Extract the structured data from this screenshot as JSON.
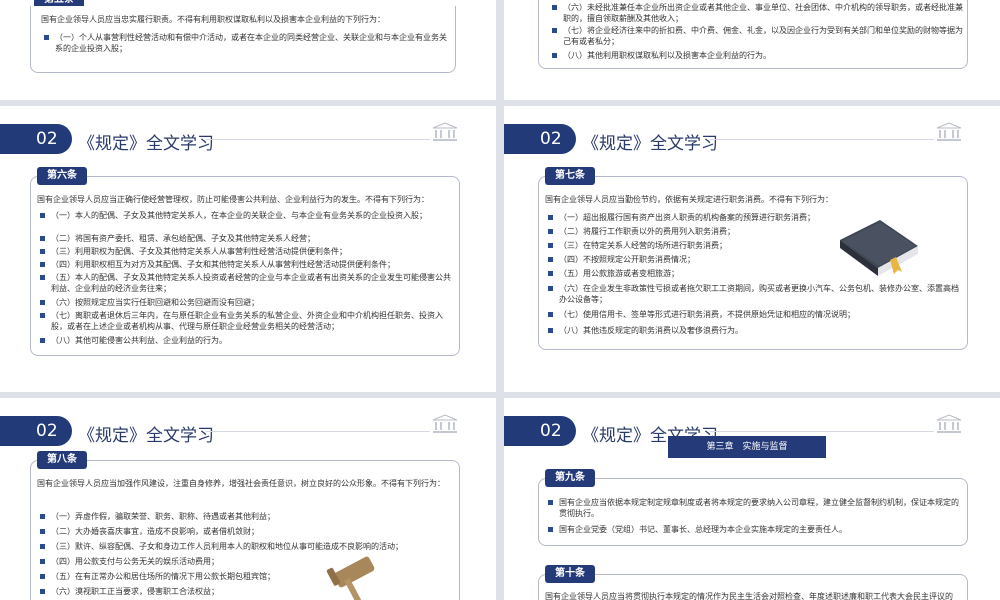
{
  "section": {
    "num": "02",
    "title": "《规定》全文学习"
  },
  "slide1": {
    "intro": "国有企业领导人员应当廉洁从业，严于律己，不得违反规定获取个人利益，并不得利用职权谋取私利。",
    "p1": "国有企业领导人员应当忠实履行职责。不得有利用职权谋取私利以及损害本企业利益的下列行为：",
    "items": [
      "（一）个人从事营利性经营活动和有偿中介活动，或者在本企业的同类经营企业、关联企业和与本企业有业务关系的企业投资入股；"
    ]
  },
  "slide2": {
    "items": [
      "（六）未经批准兼任本企业所出资企业或者其他企业、事业单位、社会团体、中介机构的领导职务，或者经批准兼职的，擅自领取薪酬及其他收入；",
      "（七）将企业经济往来中的折扣费、中介费、佣金、礼金，以及因企业行为受到有关部门和单位奖励的财物等据为己有或者私分；",
      "（八）其他利用职权谋取私利以及损害本企业利益的行为。"
    ]
  },
  "slide3": {
    "tab": "第六条",
    "intro": "国有企业领导人员应当正确行使经营管理权，防止可能侵害公共利益、企业利益行为的发生。不得有下列行为：",
    "items": [
      "（一）本人的配偶、子女及其他特定关系人，在本企业的关联企业、与本企业有业务关系的企业投资入股；",
      "（二）将国有资产委托、租赁、承包给配偶、子女及其他特定关系人经营；",
      "（三）利用职权为配偶、子女及其他特定关系人从事营利性经营活动提供便利条件；",
      "（四）利用职权相互为对方及其配偶、子女和其他特定关系人从事营利性经营活动提供便利条件；",
      "（五）本人的配偶、子女及其他特定关系人投资或者经营的企业与本企业或者有出资关系的企业发生可能侵害公共利益、企业利益的经济业务往来；",
      "（六）按照规定应当实行任职回避和公务回避而没有回避；",
      "（七）离职或者退休后三年内，在与原任职企业有业务关系的私营企业、外资企业和中介机构担任职务、投资入股，或者在上述企业或者机构从事、代理与原任职企业经营业务相关的经营活动；",
      "（八）其他可能侵害公共利益、企业利益的行为。"
    ]
  },
  "slide4": {
    "tab": "第七条",
    "intro": "国有企业领导人员应当勤俭节约，依据有关规定进行职务消费。不得有下列行为：",
    "items": [
      "（一）超出报履行国有资产出资人职责的机构备案的预算进行职务消费；",
      "（二）将履行工作职责以外的费用列入职务消费；",
      "（三）在特定关系人经营的场所进行职务消费；",
      "（四）不按照规定公开职务消费情况；",
      "（五）用公款旅游或者变相旅游；",
      "（六）在企业发生非政策性亏损或者拖欠职工工资期间，购买或者更换小汽车、公务包机、装修办公室、添置高档办公设备等；",
      "（七）使用信用卡、签单等形式进行职务消费，不提供原始凭证和相应的情况说明；",
      "（八）其他违反规定的职务消费以及奢侈浪费行为。"
    ]
  },
  "slide5": {
    "tab": "第八条",
    "intro": "国有企业领导人员应当加强作风建设，注重自身修养，增强社会责任意识，树立良好的公众形象。不得有下列行为：",
    "items": [
      "（一）弄虚作假，骗取荣誉、职务、职称、待遇或者其他利益；",
      "（二）大办婚丧喜庆事宜，造成不良影响，或者借机敛财；",
      "（三）默许、纵容配偶、子女和身边工作人员利用本人的职权和地位从事可能造成不良影响的活动；",
      "（四）用公款支付与公务无关的娱乐活动费用；",
      "（五）在有正常办公和居住场所的情况下用公款长期包租宾馆；",
      "（六）漠视职工正当要求，侵害职工合法权益；"
    ]
  },
  "slide6": {
    "chapter": "第三章　实施与监督",
    "tab1": "第九条",
    "items": [
      "国有企业应当依据本规定制定规章制度或者将本规定的要求纳入公司章程，建立健全监督制约机制，保证本规定的贯彻执行。",
      "国有企业党委（党组）书记、董事长、总经理为本企业实施本规定的主要责任人。"
    ],
    "tab2": "第十条",
    "p2": "国有企业领导人员应当将贯彻执行本规定的情况作为民主生活会对照检查、年度述职述廉和职工代表大会民主评议的内容。"
  },
  "colors": {
    "navy": "#233a78",
    "border": "#b4bacb",
    "bullet": "#2c4a8e"
  }
}
